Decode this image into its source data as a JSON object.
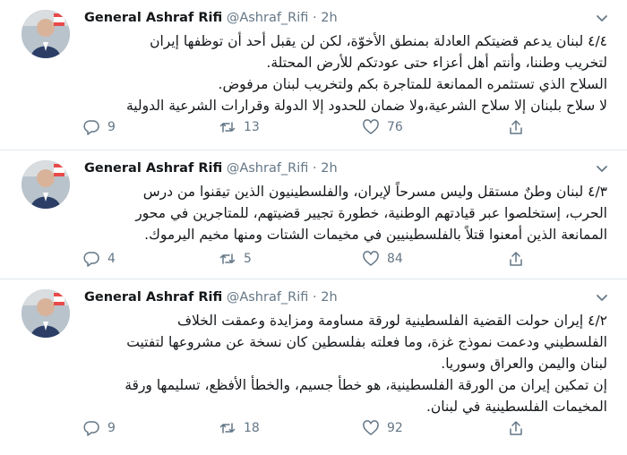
{
  "tweets": [
    {
      "name": "General Ashraf Rifi",
      "handle": "@Ashraf_Rifi",
      "time": "2h",
      "lines": [
        "٤/٤ لبنان يدعم قضيتكم العادلة بمنطق الأخوّة، لكن لن يقبل أحد أن توظفها إيران",
        "لتخريب وطننا، وأنتم أهل أعزاء حتى عودتكم للأرض المحتلة.",
        "السلاح الذي تستثمره الممانعة للمتاجرة بكم ولتخريب لبنان مرفوض.",
        "لا سلاح بلبنان إلا سلاح الشرعية،ولا ضمان للحدود إلا الدولة وقرارات الشرعية الدولية"
      ],
      "replies": "9",
      "retweets": "13",
      "likes": "76"
    },
    {
      "name": "General Ashraf Rifi",
      "handle": "@Ashraf_Rifi",
      "time": "2h",
      "lines": [
        "٤/٣ لبنان وطنٌ مستقل وليس مسرحاً لإيران، والفلسطينيون الذين تيقنوا من درس",
        "الحرب، إستخلصوا عبر قيادتهم الوطنية، خطورة تجيير قضيتهم، للمتاجرين في محور",
        "الممانعة الذين أمعنوا قتلاً بالفلسطينيين في مخيمات الشتات ومنها مخيم اليرموك."
      ],
      "replies": "4",
      "retweets": "5",
      "likes": "84"
    },
    {
      "name": "General Ashraf Rifi",
      "handle": "@Ashraf_Rifi",
      "time": "2h",
      "lines": [
        "٤/٢ إيران حولت القضية الفلسطينية لورقة مساومة ومزايدة وعمقت الخلاف",
        "الفلسطيني ودعمت نموذج غزة، وما فعلته بفلسطين كان نسخة عن مشروعها لتفتيت",
        "لبنان واليمن والعراق وسوريا.",
        "إن تمكين إيران من الورقة الفلسطينية، هو خطأ جسيم، والخطأ الأفظع، تسليمها ورقة",
        "المخيمات الفلسطينية في لبنان."
      ],
      "replies": "9",
      "retweets": "18",
      "likes": "92"
    }
  ]
}
